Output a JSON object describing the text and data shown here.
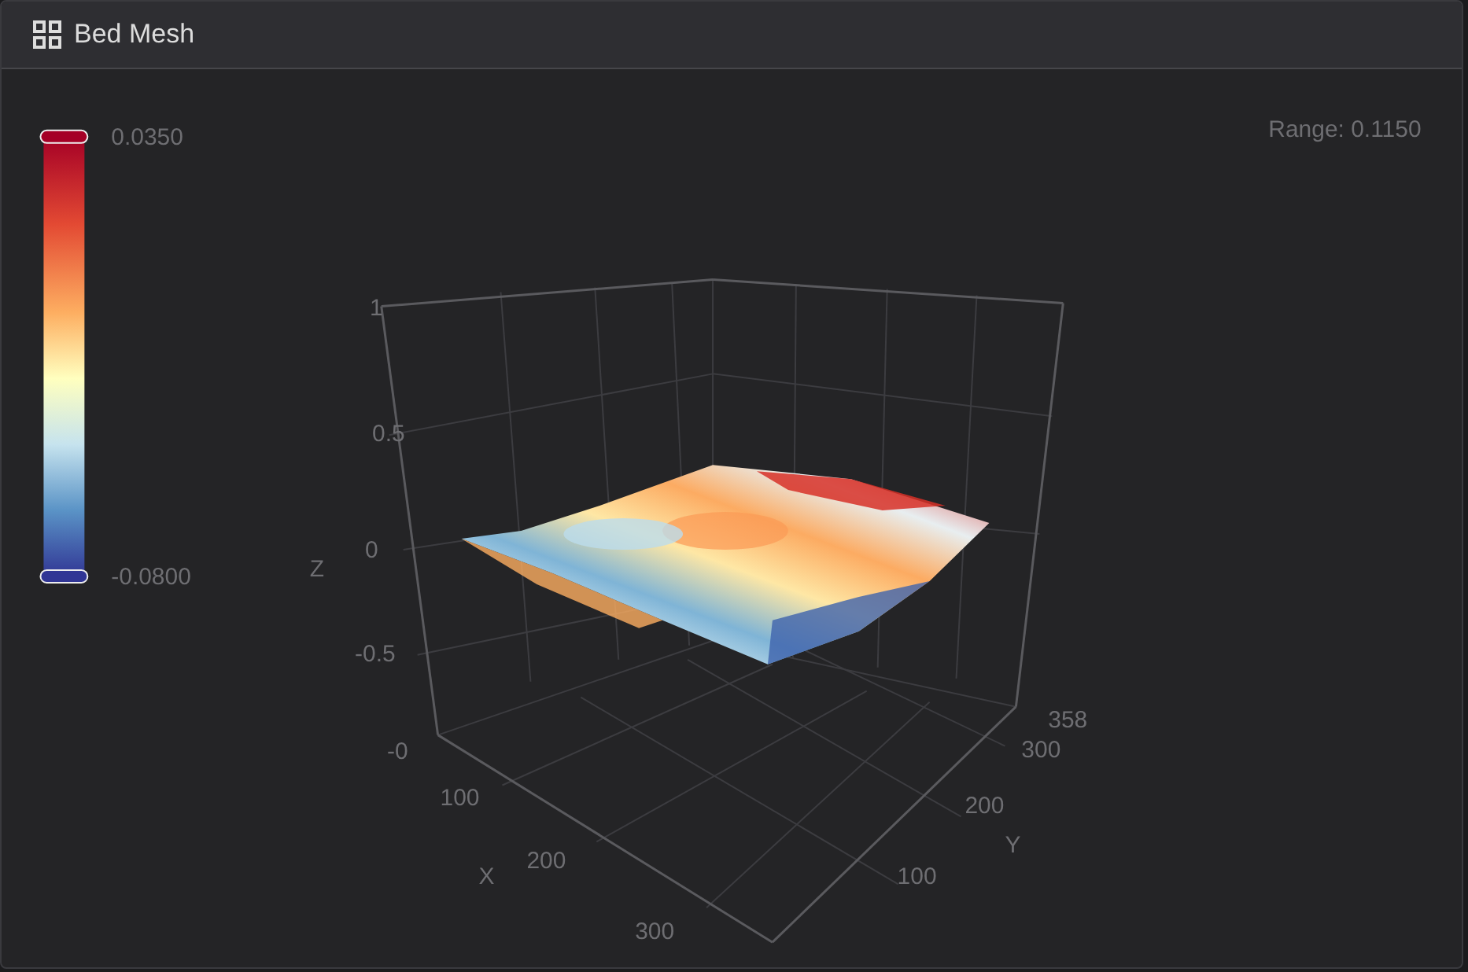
{
  "panel": {
    "title": "Bed Mesh"
  },
  "colorbar": {
    "max": "0.0350",
    "min": "-0.0800"
  },
  "range": "Range: 0.1150",
  "plot": {
    "z_axis": {
      "title": "Z",
      "ticks": [
        "1",
        "0.5",
        "0",
        "-0.5",
        "-0"
      ]
    },
    "x_axis": {
      "title": "X",
      "ticks": [
        "100",
        "200",
        "300"
      ]
    },
    "y_axis": {
      "title": "Y",
      "ticks": [
        "358",
        "300",
        "200",
        "100"
      ]
    }
  }
}
